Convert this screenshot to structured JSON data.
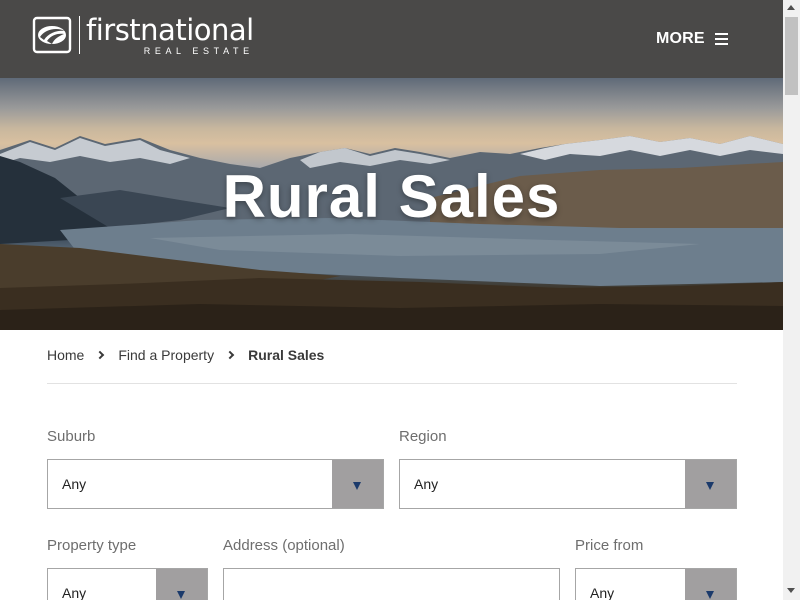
{
  "header": {
    "logo_main": "firstnational",
    "logo_sub": "REAL ESTATE",
    "more_label": "MORE",
    "background_color": "#4a4948"
  },
  "hero": {
    "title": "Rural Sales"
  },
  "breadcrumb": {
    "items": [
      "Home",
      "Find a Property",
      "Rural Sales"
    ]
  },
  "form": {
    "suburb": {
      "label": "Suburb",
      "value": "Any"
    },
    "region": {
      "label": "Region",
      "value": "Any"
    },
    "property_type": {
      "label": "Property type",
      "value": "Any"
    },
    "address": {
      "label": "Address (optional)",
      "value": ""
    },
    "price_from": {
      "label": "Price from",
      "value": "Any"
    }
  },
  "colors": {
    "select_arrow_bg": "#a19fa0",
    "select_arrow_icon": "#1b3a6b"
  }
}
